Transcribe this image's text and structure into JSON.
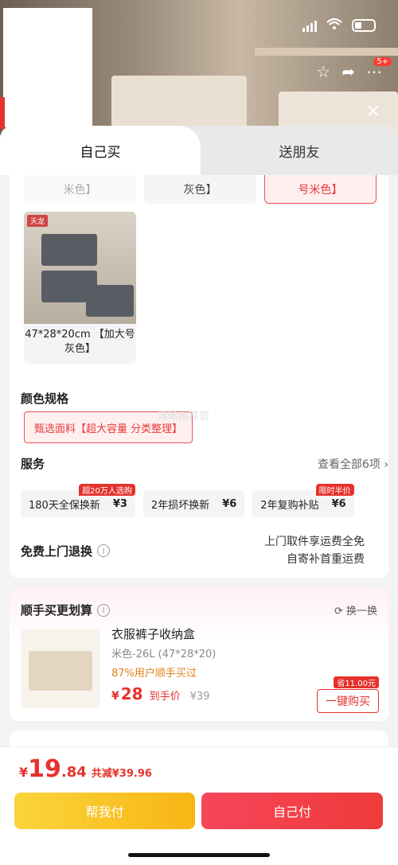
{
  "header": {
    "badge_count": "5+"
  },
  "tabs": [
    {
      "label": "自己买"
    },
    {
      "label": "送朋友"
    }
  ],
  "previous_options": [
    {
      "label": "米色】"
    },
    {
      "label": "灰色】"
    },
    {
      "label": "号米色】"
    }
  ],
  "product_tile": {
    "logo": "天龙",
    "label": "47*28*20cm 【加大号灰色】"
  },
  "color_spec": {
    "title": "颜色规格",
    "selected": "甄选面料【超大容量 分类整理】",
    "watermark": "清晰推荐官"
  },
  "service": {
    "title": "服务",
    "more": "查看全部6项",
    "items": [
      {
        "name": "180天全保换新",
        "price": "¥3",
        "tag": "超20万人选购"
      },
      {
        "name": "2年损坏换新",
        "price": "¥6",
        "tag": ""
      },
      {
        "name": "2年复购补贴",
        "price": "¥6",
        "tag": "限时半价"
      }
    ]
  },
  "free_return": {
    "label": "免费上门退换",
    "line1": "上门取件享运费全免",
    "line2": "自寄补首重运费"
  },
  "upsell": {
    "title": "顺手买更划算",
    "swap": "换一换",
    "name": "衣服裤子收纳盒",
    "spec": "米色-26L (47*28*20)",
    "hint": "87%用户顺手买过",
    "currency": "¥",
    "price": "28",
    "after_label": "到手价",
    "orig_price": "¥39",
    "save_tag": "省11.00元",
    "buy_label": "一键购买"
  },
  "footer": {
    "currency": "¥",
    "total_int": "19",
    "total_dec": ".84",
    "saving": "共减¥39.96",
    "help_pay": "帮我付",
    "self_pay": "自己付"
  },
  "colors": {
    "accent": "#e5322d",
    "help_button": "#f7b614",
    "self_button": "#ef3a3a"
  }
}
